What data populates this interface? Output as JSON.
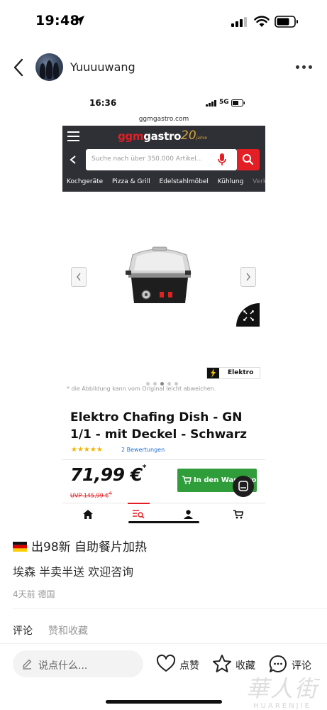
{
  "status_bar": {
    "time": "19:48"
  },
  "nav": {
    "username": "Yuuuuwang"
  },
  "screenshot": {
    "status_time": "16:36",
    "network": "5G",
    "url": "ggmgastro.com",
    "logo_ggm": "ggm",
    "logo_gastro": "gastro",
    "logo_badge": "20",
    "logo_badge_sub": "jahre",
    "search_placeholder": "Suche nach über 350.000 Artikel...",
    "categories": [
      "Kochgeräte",
      "Pizza & Grill",
      "Edelstahlmöbel",
      "Kühlung",
      "Verk"
    ],
    "category_badge": "Elektro",
    "disclaimer": "* die Abbildung kann vom Original leicht abweichen.",
    "product_title": "Elektro Chafing Dish - GN 1/1 - mit Deckel - Schwarz",
    "rating_stars": "★★★★★",
    "reviews": "2 Bewertungen",
    "price": "71,99 €",
    "price_star": "*",
    "uvp": "UVP 145,99 €",
    "uvp_sup": "4",
    "cart_button": "In den Warenkorb"
  },
  "post": {
    "title": "出98新 自助餐片加热",
    "body": "埃森 半卖半送 欢迎咨询",
    "meta": "4天前 德国"
  },
  "tabs": {
    "comments": "评论",
    "likes": "赞和收藏"
  },
  "bottom": {
    "comment_placeholder": "说点什么...",
    "like": "点赞",
    "collect": "收藏",
    "comment": "评论"
  },
  "watermark": {
    "zh": "華人街",
    "en": "HUARENJIE"
  },
  "colors": {
    "ggm_red": "#e31e24",
    "ggm_dark": "#2f2f36",
    "cart_green": "#2f9e3a",
    "star_gold": "#f5b301"
  }
}
